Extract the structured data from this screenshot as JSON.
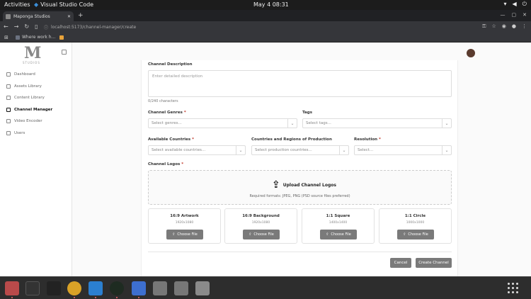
{
  "os": {
    "activities": "Activities",
    "app": "Visual Studio Code",
    "clock": "May 4  08:31"
  },
  "browser": {
    "tab_title": "Maponga Studios",
    "url": "localhost:5173/channel-manager/create",
    "bookmark": "Where work h...",
    "window_controls": [
      "—",
      "▢",
      "✕"
    ]
  },
  "sidebar": {
    "logo": "M",
    "logo_sub": "STUDIOS",
    "items": [
      {
        "label": "Dashboard",
        "icon": "grid-icon",
        "active": false
      },
      {
        "label": "Assets Library",
        "icon": "folder-icon",
        "active": false
      },
      {
        "label": "Content Library",
        "icon": "library-icon",
        "active": false
      },
      {
        "label": "Channel Manager",
        "icon": "tv-icon",
        "active": true
      },
      {
        "label": "Video Encoder",
        "icon": "video-icon",
        "active": false
      },
      {
        "label": "Users",
        "icon": "user-icon",
        "active": false
      }
    ]
  },
  "form": {
    "description": {
      "label": "Channel Description",
      "placeholder": "Enter detailed description",
      "count": "0/240 characters"
    },
    "genres": {
      "label": "Channel Genres",
      "placeholder": "Select genres..."
    },
    "tags": {
      "label": "Tags",
      "placeholder": "Select tags..."
    },
    "countries": {
      "label": "Available Countries",
      "placeholder": "Select available countries..."
    },
    "production": {
      "label": "Countries and Regions of Production",
      "placeholder": "Select production countries..."
    },
    "resolution": {
      "label": "Resolution",
      "placeholder": "Select..."
    },
    "logos": {
      "label": "Channel Logos",
      "upload_title": "Upload Channel Logos",
      "upload_sub": "Required formats: JPEG, PNG (PSD source files preferred)"
    },
    "cards": [
      {
        "title": "16:9 Artwork",
        "size": "1920x1080",
        "button": "Choose File"
      },
      {
        "title": "16:9 Background",
        "size": "1920x1080",
        "button": "Choose File"
      },
      {
        "title": "1:1 Square",
        "size": "1400x1400",
        "button": "Choose File"
      },
      {
        "title": "1:1 Circle",
        "size": "1000x1000",
        "button": "Choose File"
      }
    ],
    "cancel": "Cancel",
    "create": "Create Channel"
  },
  "colors": {
    "button": "#7a7a7a",
    "required": "#c0392b"
  }
}
